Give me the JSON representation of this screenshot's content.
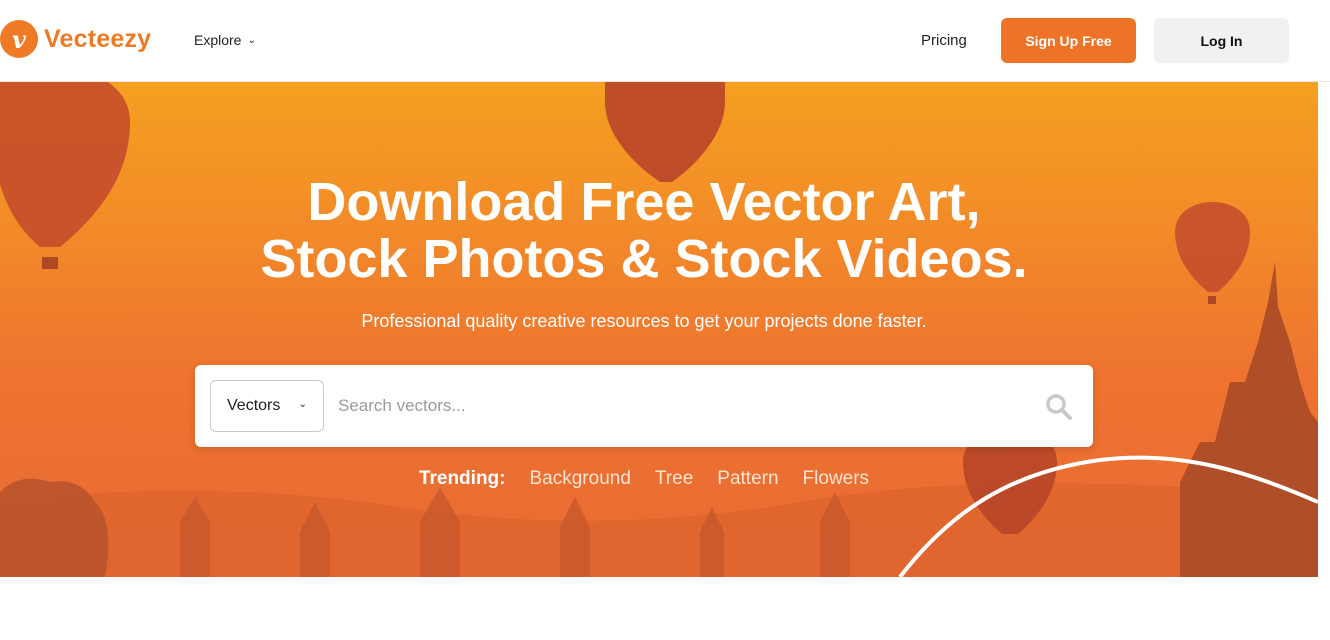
{
  "header": {
    "logo_text": "Vecteezy",
    "explore_label": "Explore",
    "pricing_label": "Pricing",
    "signup_label": "Sign Up Free",
    "login_label": "Log In"
  },
  "hero": {
    "headline_line1": "Download Free Vector Art,",
    "headline_line2": "Stock Photos & Stock Videos.",
    "subheading": "Professional quality creative resources to get your projects done faster."
  },
  "search": {
    "type_selected": "Vectors",
    "placeholder": "Search vectors..."
  },
  "trending": {
    "label": "Trending:",
    "tags": [
      "Background",
      "Tree",
      "Pattern",
      "Flowers"
    ]
  },
  "colors": {
    "brand": "#ee7326",
    "login_bg": "#f0f1f3"
  }
}
